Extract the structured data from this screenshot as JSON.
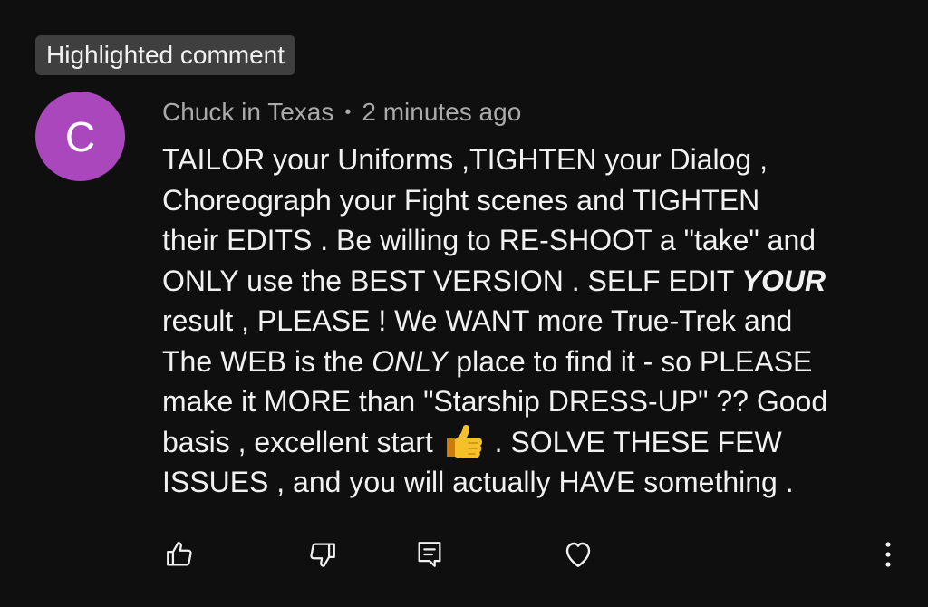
{
  "badge": {
    "label": "Highlighted comment"
  },
  "comment": {
    "avatar_letter": "C",
    "avatar_color": "#ab47bc",
    "author": "Chuck in Texas",
    "separator": "•",
    "timestamp": "2 minutes ago",
    "body": {
      "line1": "TAILOR your Uniforms ,TIGHTEN your Dialog ,",
      "line2": "Choreograph your Fight scenes and TIGHTEN",
      "line3": "their EDITS . Be willing to RE-SHOOT a \"take\" and",
      "line4a": "ONLY use the BEST VERSION . SELF EDIT ",
      "line4b": "YOUR",
      "line5": "result , PLEASE ! We WANT more True-Trek and",
      "line6a": "The WEB is the ",
      "line6b": "ONLY",
      "line6c": " place to find it - so PLEASE",
      "line7": "make it MORE than \"Starship DRESS-UP\" ?? Good",
      "line8a": "basis , excellent start ",
      "line8b": " . SOLVE THESE FEW",
      "line9": "ISSUES , and you will actually HAVE something ."
    },
    "emoji": "thumbs-up-emoji"
  },
  "actions": [
    {
      "icon": "thumbs-up-icon"
    },
    {
      "icon": "thumbs-down-icon"
    },
    {
      "icon": "reply-icon"
    },
    {
      "icon": "heart-icon"
    },
    {
      "icon": "more-vertical-icon"
    }
  ]
}
